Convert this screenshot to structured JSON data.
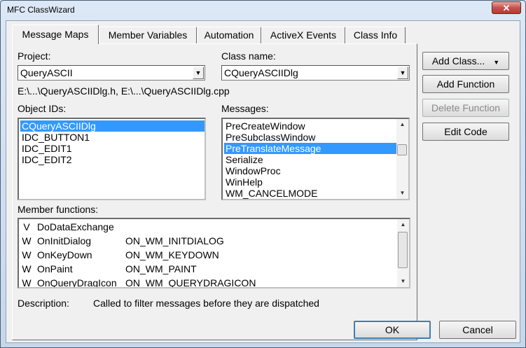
{
  "window": {
    "title": "MFC ClassWizard",
    "close_glyph": "✕"
  },
  "tabs": [
    {
      "label": "Message Maps"
    },
    {
      "label": "Member Variables"
    },
    {
      "label": "Automation"
    },
    {
      "label": "ActiveX Events"
    },
    {
      "label": "Class Info"
    }
  ],
  "project": {
    "label": "Project:",
    "value": "QueryASCII"
  },
  "class_name": {
    "label": "Class name:",
    "value": "CQueryASCIIDlg"
  },
  "files": "E:\\...\\QueryASCIIDlg.h, E:\\...\\QueryASCIIDlg.cpp",
  "object_ids": {
    "label": "Object IDs:",
    "items": [
      "CQueryASCIIDlg",
      "IDC_BUTTON1",
      "IDC_EDIT1",
      "IDC_EDIT2"
    ],
    "selected": "CQueryASCIIDlg"
  },
  "messages": {
    "label": "Messages:",
    "items": [
      "PreCreateWindow",
      "PreSubclassWindow",
      "PreTranslateMessage",
      "Serialize",
      "WindowProc",
      "WinHelp",
      "WM_CANCELMODE"
    ],
    "selected": "PreTranslateMessage"
  },
  "member_functions": {
    "label": "Member functions:",
    "rows": [
      {
        "code": "V",
        "name": "DoDataExchange",
        "message": ""
      },
      {
        "code": "W",
        "name": "OnInitDialog",
        "message": "ON_WM_INITDIALOG"
      },
      {
        "code": "W",
        "name": "OnKeyDown",
        "message": "ON_WM_KEYDOWN"
      },
      {
        "code": "W",
        "name": "OnPaint",
        "message": "ON_WM_PAINT"
      },
      {
        "code": "W",
        "name": "OnQueryDragIcon",
        "message": "ON_WM_QUERYDRAGICON"
      }
    ]
  },
  "description": {
    "label": "Description:",
    "text": "Called to filter messages before they are dispatched"
  },
  "buttons": {
    "add_class": "Add Class...",
    "add_function": "Add Function",
    "delete_function": "Delete Function",
    "edit_code": "Edit Code",
    "ok": "OK",
    "cancel": "Cancel"
  },
  "colors": {
    "selection": "#3399ff"
  }
}
